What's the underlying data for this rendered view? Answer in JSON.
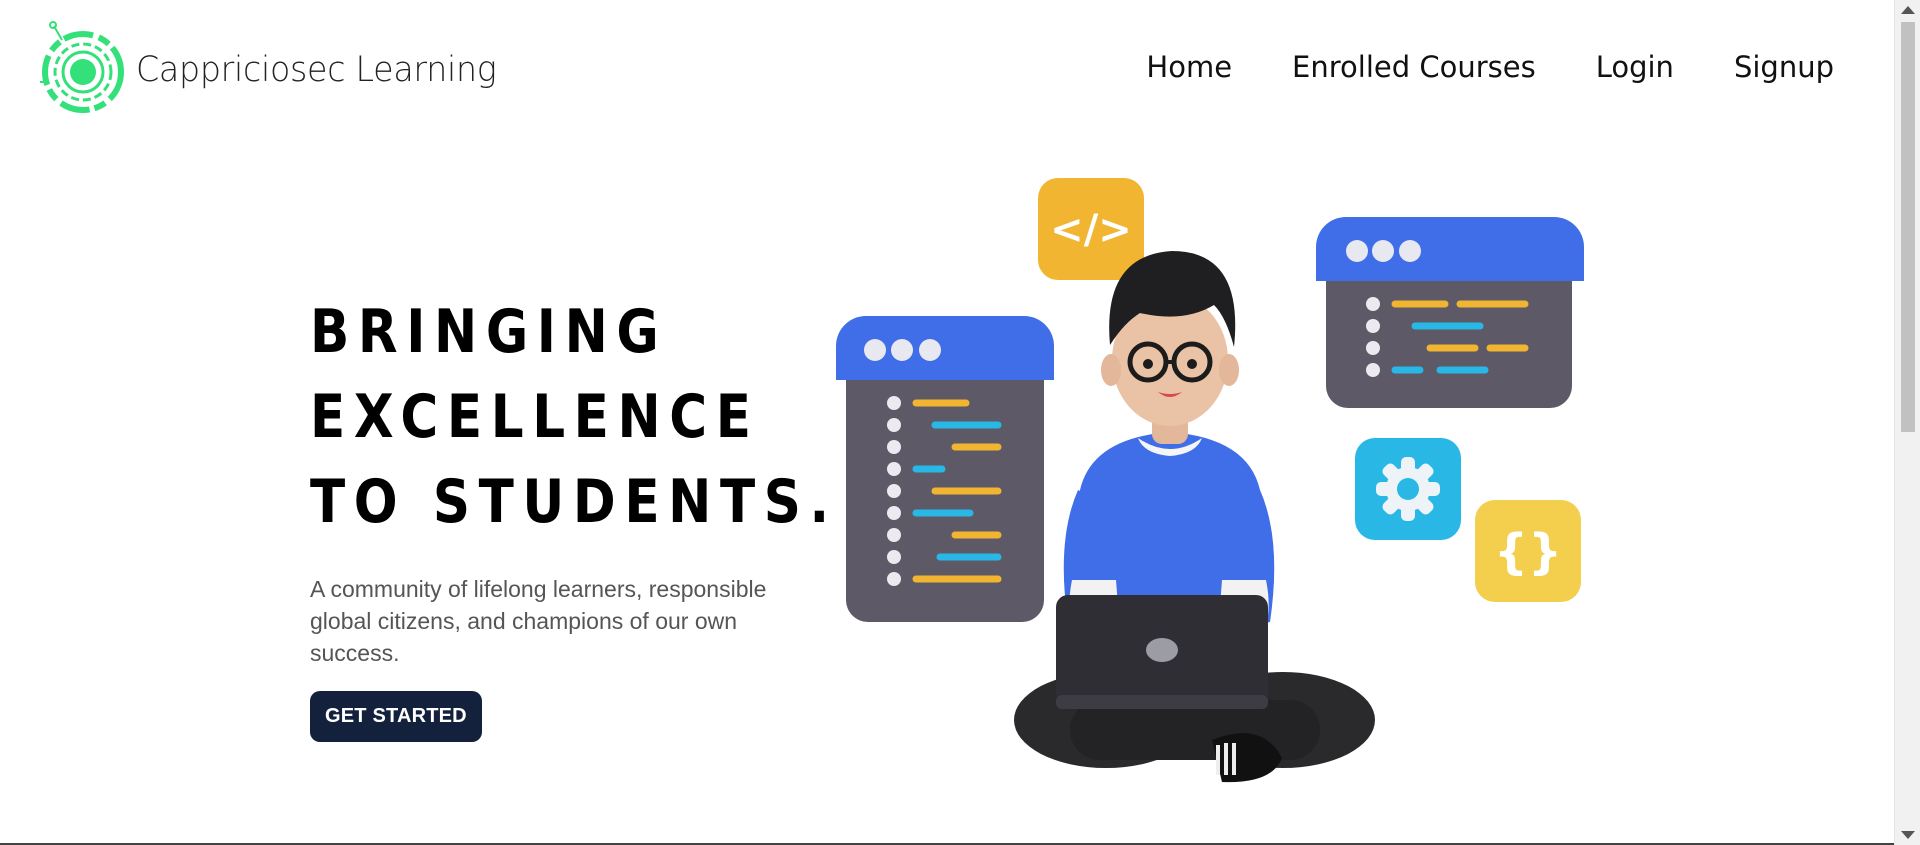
{
  "brand": {
    "name": "Cappriciosec Learning",
    "logo_icon": "circuit-circle-logo",
    "logo_color": "#33e07a"
  },
  "nav": [
    {
      "label": "Home"
    },
    {
      "label": "Enrolled Courses"
    },
    {
      "label": "Login"
    },
    {
      "label": "Signup"
    }
  ],
  "hero": {
    "headline": [
      "BRINGING",
      "EXCELLENCE",
      "TO STUDENTS."
    ],
    "description": "A community of lifelong learners, responsible global citizens, and champions of our own success.",
    "cta_label": "GET STARTED",
    "cta_color": "#14213d"
  },
  "illustration": {
    "code_icon": "</>",
    "braces_icon": "{}",
    "gear_icon": "gear-icon",
    "accent_blue": "#3f6ee8",
    "accent_yellow": "#f2b531",
    "accent_cyan": "#29b8e6"
  }
}
